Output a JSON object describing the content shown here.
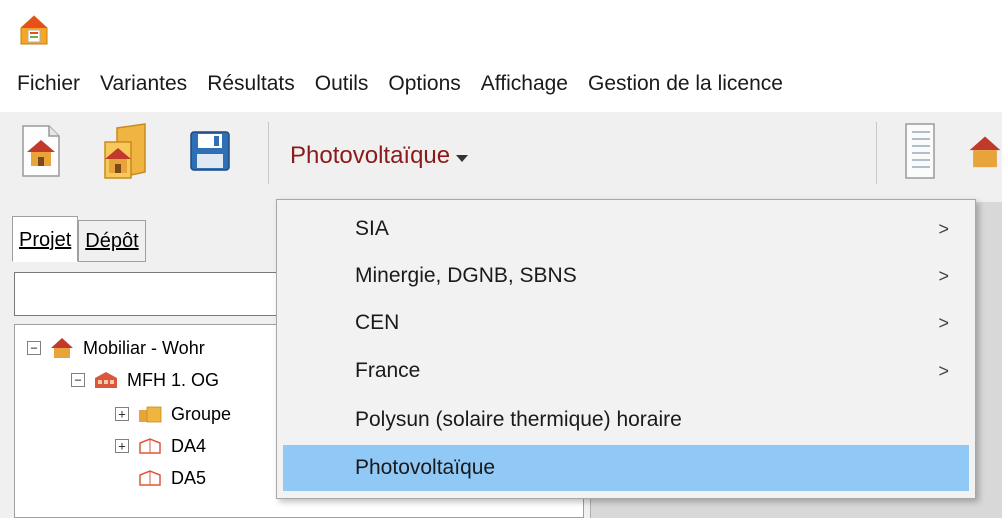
{
  "menubar": {
    "items": [
      "Fichier",
      "Variantes",
      "Résultats",
      "Outils",
      "Options",
      "Affichage",
      "Gestion de la licence"
    ]
  },
  "toolbar": {
    "buttons": [
      "new-project-icon",
      "open-project-icon",
      "save-icon",
      "report-icon",
      "house-icon"
    ],
    "variant_dropdown_label": "Photovoltaïque"
  },
  "panel": {
    "tabs": [
      {
        "label": "Projet",
        "active": true
      },
      {
        "label": "Dépôt",
        "active": false
      }
    ],
    "search_value": "",
    "tree": [
      {
        "label": "Mobiliar - Wohr",
        "expander": "−",
        "icon": "house-icon"
      },
      {
        "label": "MFH 1. OG",
        "expander": "−",
        "icon": "building-icon"
      },
      {
        "label": "Groupe",
        "expander": "+",
        "icon": "building-group-icon"
      },
      {
        "label": "DA4",
        "expander": "+",
        "icon": "zone-icon"
      },
      {
        "label": "DA5",
        "expander": "",
        "icon": "zone-icon"
      }
    ]
  },
  "dropdown": {
    "items": [
      {
        "label": "SIA",
        "submenu": true,
        "arrow": ">"
      },
      {
        "label": "Minergie, DGNB, SBNS",
        "submenu": true,
        "arrow": ">"
      },
      {
        "label": "CEN",
        "submenu": true,
        "arrow": ">"
      },
      {
        "label": "France",
        "submenu": true,
        "arrow": ">"
      },
      {
        "label": "Polysun (solaire thermique) horaire",
        "submenu": false,
        "arrow": ""
      },
      {
        "label": "Photovoltaïque",
        "submenu": false,
        "arrow": "",
        "highlighted": true
      }
    ]
  },
  "colors": {
    "accent_red": "#8b1a1a",
    "highlight_blue": "#90c8f6"
  }
}
